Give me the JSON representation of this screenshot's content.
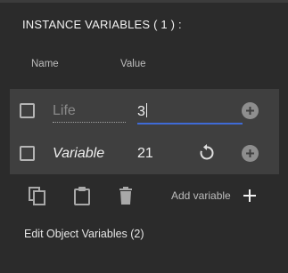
{
  "section": {
    "title": "INSTANCE VARIABLES ( 1 ) :"
  },
  "columns": {
    "name": "Name",
    "value": "Value"
  },
  "variables": [
    {
      "name_placeholder": "Life",
      "value": "3",
      "state": "editing",
      "checked": false
    },
    {
      "name": "Variable",
      "value": "21",
      "state": "set",
      "checked": false
    }
  ],
  "toolbar": {
    "add_label": "Add variable",
    "icons": [
      "copy-icon",
      "paste-icon",
      "trash-icon",
      "plus-icon"
    ]
  },
  "footer": {
    "edit_link": "Edit Object Variables (2)"
  },
  "colors": {
    "background": "#2b2b2b",
    "panel": "#3f3f3f",
    "focus_underline": "#3f6bd6"
  }
}
